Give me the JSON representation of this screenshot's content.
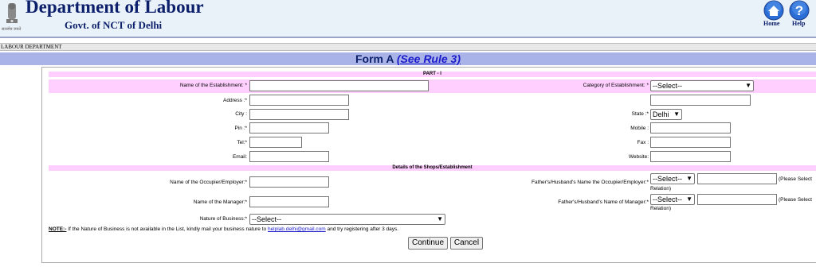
{
  "header": {
    "title": "Department of Labour",
    "subtitle": "Govt. of NCT of Delhi",
    "home_label": "Home",
    "help_label": "Help",
    "emblem_text": "सत्यमेव जयते"
  },
  "breadcrumb": "LABOUR DEPARTMENT",
  "form": {
    "title": "Form A",
    "rule_link": "(See Rule 3)",
    "part_label": "PART - I",
    "section2_label": "Details of the Shops/Establishment"
  },
  "fields": {
    "establishment_name": "Name of the Establishment: *",
    "category": "Category of Establishment: *",
    "category_value": "--Select--",
    "address": "Address :*",
    "city": "City :",
    "state": "State :*",
    "state_value": "Delhi",
    "pin": "Pin :*",
    "mobile": "Mobile :",
    "tel": "Tel:*",
    "fax": "Fax :",
    "email": "Email:",
    "website": "Website:",
    "occupier": "Name of the Occupier/Employer:*",
    "occupier_father": "Father's/Husband's Name the Occupier/Employer:*",
    "manager": "Name of the Manager:*",
    "manager_father": "Father's/Husband's Name of Manager:*",
    "relation_value": "--Select--",
    "relation_hint_1": "(Please Select",
    "relation_hint_2": "Relation)",
    "nature": "Nature of Business:*",
    "nature_value": "--Select--"
  },
  "note": {
    "prefix": "NOTE:-",
    "text": " If the Nature of Business is not available in the List, kindly mail your business nature to ",
    "email": "helplab.delhi@gmail.com",
    "suffix": "  and try registering after 3 days."
  },
  "buttons": {
    "continue": "Continue",
    "cancel": "Cancel"
  },
  "colors": {
    "header_bg": "#eaf2f9",
    "title_color": "#0b1f6b",
    "form_bar": "#aab3e8",
    "band_pink": "#ffd0ff",
    "icon_blue": "#2b6fd6"
  },
  "icons": [
    "emblem-icon",
    "home-icon",
    "help-icon"
  ]
}
